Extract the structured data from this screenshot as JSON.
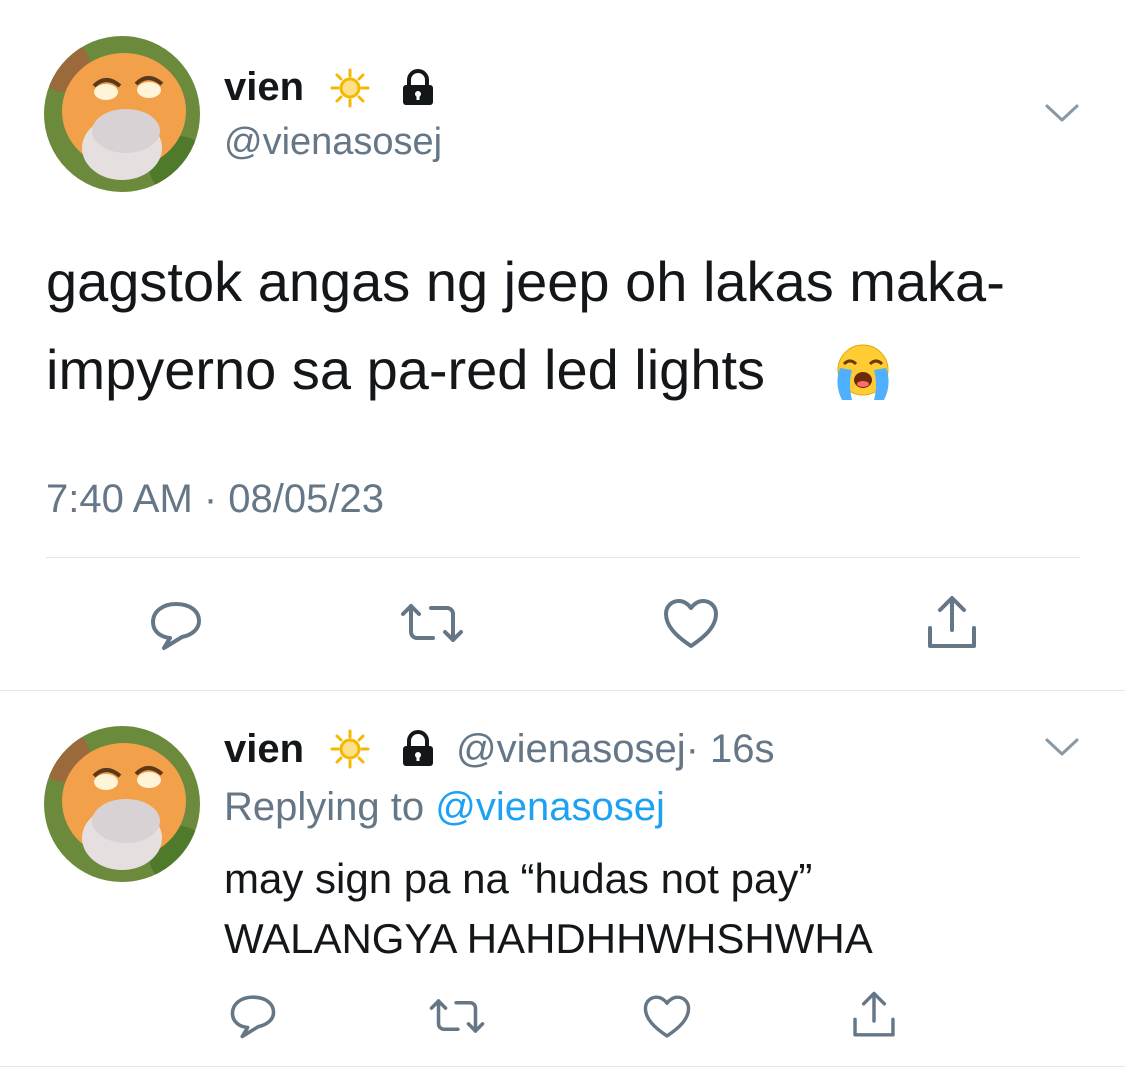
{
  "main_tweet": {
    "author_name": "vien",
    "handle": "@vienasosej",
    "text_line1": "gagstok angas ng jeep oh lakas maka-",
    "text_line2": "impyerno sa pa-red led lights",
    "time": "7:40 AM · 08/05/23"
  },
  "reply_tweet": {
    "author_name": "vien",
    "handle": "@vienasosej",
    "age": "· 16s",
    "replying_to_label": "Replying to",
    "replying_to_handle": "@vienasosej",
    "text_line1": "may sign pa na “hudas not pay”",
    "text_line2": "WALANGYA HAHDHHWHSHWHA"
  },
  "icons": {
    "verified_sun": "sun-icon",
    "protected": "lock-icon",
    "crying_emoji": "loudly-crying-face",
    "reply": "reply-icon",
    "retweet": "retweet-icon",
    "like": "heart-icon",
    "share": "share-icon",
    "menu": "chevron-down-icon"
  },
  "colors": {
    "text": "#14171a",
    "muted": "#657786",
    "link": "#1da1f2",
    "divider": "#e1e8ed",
    "sun": "#f5b800"
  }
}
